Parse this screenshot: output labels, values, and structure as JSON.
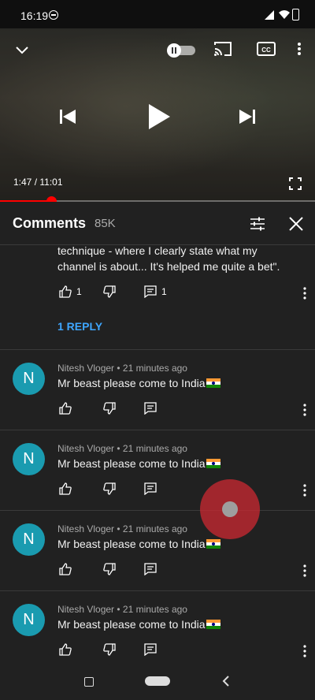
{
  "status_bar": {
    "time": "16:19"
  },
  "video": {
    "time_display": "1:47 / 11:01",
    "progress_fraction": 0.162
  },
  "comments_panel": {
    "title": "Comments",
    "count": "85K",
    "continued_comment": {
      "text_line1": "technique - where I clearly  state what my",
      "text_line2": "channel is about... It's helped me quite a bet\".",
      "like_count": "1",
      "reply_count": "1",
      "replies_link": "1 REPLY"
    },
    "comments": [
      {
        "avatar_letter": "N",
        "meta": "Nitesh Vloger • 21 minutes ago",
        "text": "Mr beast please come to India"
      },
      {
        "avatar_letter": "N",
        "meta": "Nitesh Vloger • 21 minutes ago",
        "text": "Mr beast please come to India"
      },
      {
        "avatar_letter": "N",
        "meta": "Nitesh Vloger • 21 minutes ago",
        "text": "Mr beast please come to India"
      },
      {
        "avatar_letter": "N",
        "meta": "Nitesh Vloger • 21 minutes ago",
        "text": "Mr beast please come to India"
      }
    ]
  },
  "icons": [
    "collapse-chevron-icon",
    "autoplay-toggle-icon",
    "cast-icon",
    "captions-icon",
    "more-vertical-icon",
    "previous-icon",
    "play-icon",
    "next-icon",
    "fullscreen-icon",
    "filter-icon",
    "close-icon",
    "like-icon",
    "dislike-icon",
    "reply-icon",
    "flag-india-icon"
  ],
  "colors": {
    "progress": "#ff0000",
    "link": "#3ea6ff",
    "avatar": "#1a9bb0",
    "panel_bg": "#212121"
  }
}
